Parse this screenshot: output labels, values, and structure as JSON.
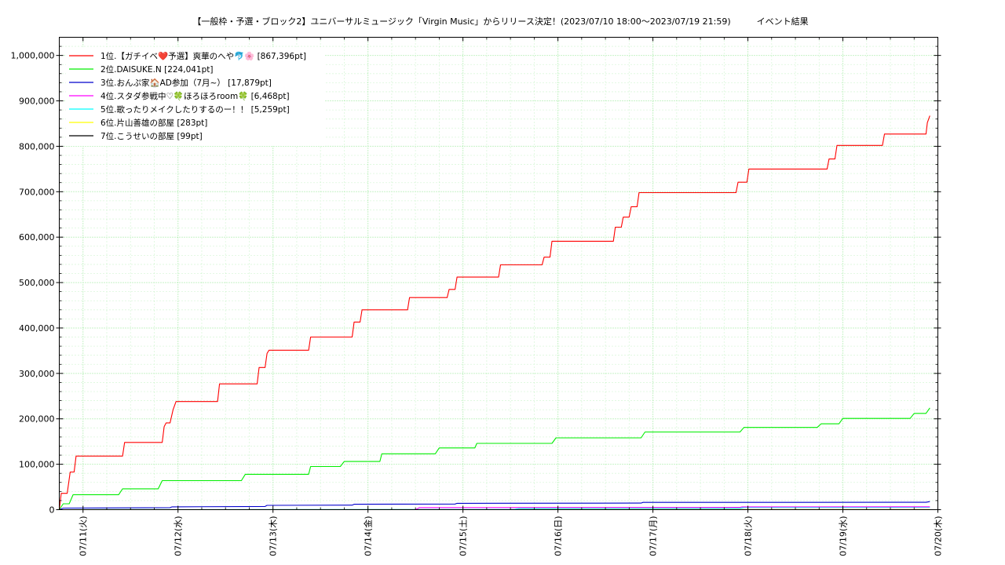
{
  "chart_data": {
    "type": "line",
    "title": "【一般枠・予選・ブロック2】ユニバーサルミュージック「Virgin Music」からリリース決定！(2023/07/10 18:00～2023/07/19 21:59)　　　イベント結果",
    "xlabel": "",
    "ylabel": "",
    "x_range": [
      "2023/07/10 18:00",
      "2023/07/20 00:00"
    ],
    "ylim": [
      0,
      1040000
    ],
    "y_ticks": [
      0,
      100000,
      200000,
      300000,
      400000,
      500000,
      600000,
      700000,
      800000,
      900000,
      1000000
    ],
    "y_tick_labels": [
      "0",
      "100,000",
      "200,000",
      "300,000",
      "400,000",
      "500,000",
      "600,000",
      "700,000",
      "800,000",
      "900,000",
      "1,000,000"
    ],
    "x_ticks": [
      "2023/07/11 00:00",
      "2023/07/12 00:00",
      "2023/07/13 00:00",
      "2023/07/14 00:00",
      "2023/07/15 00:00",
      "2023/07/16 00:00",
      "2023/07/17 00:00",
      "2023/07/18 00:00",
      "2023/07/19 00:00",
      "2023/07/20 00:00"
    ],
    "x_tick_labels": [
      "07/11(火)",
      "07/12(水)",
      "07/13(木)",
      "07/14(金)",
      "07/15(土)",
      "07/16(日)",
      "07/17(月)",
      "07/18(火)",
      "07/19(水)",
      "07/20(木)"
    ],
    "grid": true,
    "legend_position": "top-left",
    "series": [
      {
        "name": "1位.【ガチイベ❤️予選】爽華のへや🐬🌸 [867,396pt]",
        "color": "#ff0000",
        "points": [
          [
            "2023/07/10 18:00",
            0
          ],
          [
            "2023/07/10 18:30",
            36000
          ],
          [
            "2023/07/10 20:00",
            36000
          ],
          [
            "2023/07/10 20:45",
            83000
          ],
          [
            "2023/07/10 21:45",
            83000
          ],
          [
            "2023/07/10 22:15",
            118000
          ],
          [
            "2023/07/11 10:00",
            118000
          ],
          [
            "2023/07/11 10:30",
            148000
          ],
          [
            "2023/07/11 20:00",
            148000
          ],
          [
            "2023/07/11 20:30",
            183000
          ],
          [
            "2023/07/11 21:00",
            191000
          ],
          [
            "2023/07/11 22:00",
            191000
          ],
          [
            "2023/07/11 22:45",
            220000
          ],
          [
            "2023/07/11 23:30",
            238000
          ],
          [
            "2023/07/12 10:00",
            238000
          ],
          [
            "2023/07/12 10:30",
            277000
          ],
          [
            "2023/07/12 20:00",
            277000
          ],
          [
            "2023/07/12 20:30",
            313000
          ],
          [
            "2023/07/12 22:00",
            313000
          ],
          [
            "2023/07/12 22:30",
            344000
          ],
          [
            "2023/07/12 23:00",
            351000
          ],
          [
            "2023/07/13 09:00",
            351000
          ],
          [
            "2023/07/13 09:30",
            380000
          ],
          [
            "2023/07/13 20:00",
            380000
          ],
          [
            "2023/07/13 20:30",
            413000
          ],
          [
            "2023/07/13 22:00",
            413000
          ],
          [
            "2023/07/13 22:30",
            440000
          ],
          [
            "2023/07/14 10:00",
            440000
          ],
          [
            "2023/07/14 10:30",
            467000
          ],
          [
            "2023/07/14 20:00",
            467000
          ],
          [
            "2023/07/14 20:30",
            485000
          ],
          [
            "2023/07/14 22:00",
            485000
          ],
          [
            "2023/07/14 22:30",
            512000
          ],
          [
            "2023/07/15 09:00",
            512000
          ],
          [
            "2023/07/15 09:30",
            539000
          ],
          [
            "2023/07/15 20:00",
            539000
          ],
          [
            "2023/07/15 20:30",
            556000
          ],
          [
            "2023/07/15 22:00",
            556000
          ],
          [
            "2023/07/15 22:30",
            591000
          ],
          [
            "2023/07/16 14:00",
            591000
          ],
          [
            "2023/07/16 14:30",
            622000
          ],
          [
            "2023/07/16 16:00",
            622000
          ],
          [
            "2023/07/16 16:30",
            644000
          ],
          [
            "2023/07/16 18:00",
            644000
          ],
          [
            "2023/07/16 18:30",
            667000
          ],
          [
            "2023/07/16 20:00",
            667000
          ],
          [
            "2023/07/16 20:30",
            698000
          ],
          [
            "2023/07/17 21:00",
            698000
          ],
          [
            "2023/07/17 21:30",
            721000
          ],
          [
            "2023/07/17 23:45",
            721000
          ],
          [
            "2023/07/18 00:15",
            750000
          ],
          [
            "2023/07/18 20:00",
            750000
          ],
          [
            "2023/07/18 20:30",
            772000
          ],
          [
            "2023/07/18 22:00",
            772000
          ],
          [
            "2023/07/18 22:30",
            802000
          ],
          [
            "2023/07/19 10:00",
            802000
          ],
          [
            "2023/07/19 10:30",
            827000
          ],
          [
            "2023/07/19 21:00",
            827000
          ],
          [
            "2023/07/19 21:20",
            852000
          ],
          [
            "2023/07/19 21:59",
            867396
          ]
        ]
      },
      {
        "name": "2位.DAISUKE.N [224,041pt]",
        "color": "#00ee00",
        "points": [
          [
            "2023/07/10 18:00",
            0
          ],
          [
            "2023/07/10 19:00",
            13000
          ],
          [
            "2023/07/10 20:30",
            13000
          ],
          [
            "2023/07/10 21:30",
            33000
          ],
          [
            "2023/07/11 09:00",
            33000
          ],
          [
            "2023/07/11 10:00",
            46000
          ],
          [
            "2023/07/11 19:00",
            46000
          ],
          [
            "2023/07/11 20:00",
            64000
          ],
          [
            "2023/07/12 16:00",
            64000
          ],
          [
            "2023/07/12 17:00",
            78000
          ],
          [
            "2023/07/13 09:00",
            78000
          ],
          [
            "2023/07/13 09:30",
            95000
          ],
          [
            "2023/07/13 17:00",
            95000
          ],
          [
            "2023/07/13 18:00",
            106000
          ],
          [
            "2023/07/14 03:00",
            106000
          ],
          [
            "2023/07/14 03:30",
            123000
          ],
          [
            "2023/07/14 17:00",
            123000
          ],
          [
            "2023/07/14 18:00",
            136000
          ],
          [
            "2023/07/15 03:00",
            136000
          ],
          [
            "2023/07/15 03:30",
            146000
          ],
          [
            "2023/07/15 22:30",
            146000
          ],
          [
            "2023/07/15 23:30",
            158000
          ],
          [
            "2023/07/16 21:00",
            158000
          ],
          [
            "2023/07/16 22:00",
            171000
          ],
          [
            "2023/07/17 22:00",
            171000
          ],
          [
            "2023/07/17 23:00",
            181000
          ],
          [
            "2023/07/18 17:30",
            181000
          ],
          [
            "2023/07/18 18:30",
            189000
          ],
          [
            "2023/07/18 23:00",
            189000
          ],
          [
            "2023/07/19 00:00",
            201000
          ],
          [
            "2023/07/19 17:00",
            201000
          ],
          [
            "2023/07/19 18:00",
            212000
          ],
          [
            "2023/07/19 21:00",
            212000
          ],
          [
            "2023/07/19 21:59",
            224041
          ]
        ]
      },
      {
        "name": "3位.おんぷ家🏠AD参加（7月~） [17,879pt]",
        "color": "#0000cc",
        "points": [
          [
            "2023/07/10 18:00",
            0
          ],
          [
            "2023/07/10 19:00",
            3500
          ],
          [
            "2023/07/11 22:00",
            4500
          ],
          [
            "2023/07/11 22:30",
            6200
          ],
          [
            "2023/07/12 22:00",
            7000
          ],
          [
            "2023/07/12 22:30",
            9500
          ],
          [
            "2023/07/13 20:00",
            10000
          ],
          [
            "2023/07/13 20:30",
            12000
          ],
          [
            "2023/07/14 22:00",
            12500
          ],
          [
            "2023/07/14 22:30",
            14000
          ],
          [
            "2023/07/16 21:00",
            14500
          ],
          [
            "2023/07/16 21:30",
            16000
          ],
          [
            "2023/07/19 21:00",
            16200
          ],
          [
            "2023/07/19 21:59",
            17879
          ]
        ]
      },
      {
        "name": "4位.スタダ参戦中♡🍀ほろほろroom🍀 [6,468pt]",
        "color": "#ff00ff",
        "points": [
          [
            "2023/07/10 18:00",
            0
          ],
          [
            "2023/07/14 12:00",
            0
          ],
          [
            "2023/07/14 13:00",
            4500
          ],
          [
            "2023/07/17 22:00",
            5000
          ],
          [
            "2023/07/17 22:30",
            6300
          ],
          [
            "2023/07/19 21:59",
            6468
          ]
        ]
      },
      {
        "name": "5位.歌ったりメイクしたりするのー！！ [5,259pt]",
        "color": "#00ffff",
        "points": [
          [
            "2023/07/10 18:00",
            0
          ],
          [
            "2023/07/15 13:00",
            500
          ],
          [
            "2023/07/15 14:00",
            2500
          ],
          [
            "2023/07/17 22:00",
            3000
          ],
          [
            "2023/07/17 23:00",
            4800
          ],
          [
            "2023/07/19 21:59",
            5259
          ]
        ]
      },
      {
        "name": "6位.片山善雄の部屋 [283pt]",
        "color": "#ffff00",
        "points": [
          [
            "2023/07/10 18:00",
            0
          ],
          [
            "2023/07/12 12:00",
            150
          ],
          [
            "2023/07/19 21:59",
            283
          ]
        ]
      },
      {
        "name": "7位.こうせいの部屋 [99pt]",
        "color": "#000000",
        "points": [
          [
            "2023/07/10 18:00",
            0
          ],
          [
            "2023/07/13 12:00",
            60
          ],
          [
            "2023/07/19 21:59",
            99
          ]
        ]
      }
    ]
  }
}
